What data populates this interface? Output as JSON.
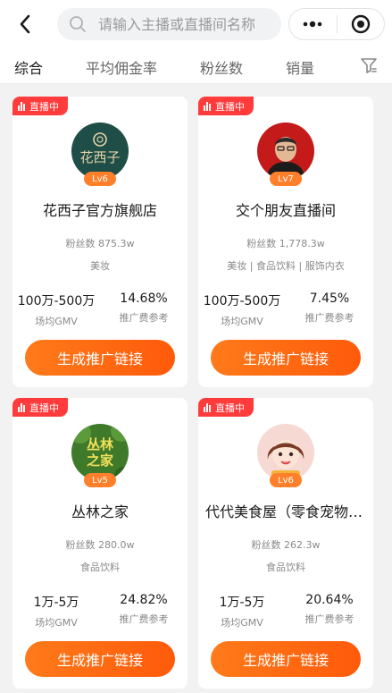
{
  "search": {
    "placeholder": "请输入主播或直播间名称"
  },
  "tabs": [
    {
      "label": "综合"
    },
    {
      "label": "平均佣金率"
    },
    {
      "label": "粉丝数"
    },
    {
      "label": "销量"
    }
  ],
  "cards": [
    {
      "live_label": "直播中",
      "level": "Lv6",
      "name": "花西子官方旗舰店",
      "fans": "粉丝数 875.3w",
      "categories": "美妆",
      "gmv": "100万-500万",
      "gmv_label": "场均GMV",
      "fee": "14.68%",
      "fee_label": "推广费参考",
      "cta": "生成推广链接",
      "avatar_text": "花西子"
    },
    {
      "live_label": "直播中",
      "level": "Lv7",
      "name": "交个朋友直播间",
      "fans": "粉丝数 1,778.3w",
      "categories": "美妆 | 食品饮料 | 服饰内衣",
      "gmv": "100万-500万",
      "gmv_label": "场均GMV",
      "fee": "7.45%",
      "fee_label": "推广费参考",
      "cta": "生成推广链接"
    },
    {
      "live_label": "直播中",
      "level": "Lv5",
      "name": "丛林之家",
      "fans": "粉丝数 280.0w",
      "categories": "食品饮料",
      "gmv": "1万-5万",
      "gmv_label": "场均GMV",
      "fee": "24.82%",
      "fee_label": "推广费参考",
      "cta": "生成推广链接",
      "avatar_text_1": "丛林",
      "avatar_text_2": "之家"
    },
    {
      "live_label": "直播中",
      "level": "Lv6",
      "name": "代代美食屋（零食宠物店）",
      "fans": "粉丝数 262.3w",
      "categories": "食品饮料",
      "gmv": "1万-5万",
      "gmv_label": "场均GMV",
      "fee": "20.64%",
      "fee_label": "推广费参考",
      "cta": "生成推广链接"
    }
  ],
  "icons": {
    "back": "chevron-left-icon",
    "search": "search-icon",
    "more": "more-dots-icon",
    "close": "target-close-icon",
    "filter": "filter-icon",
    "live": "live-bars-icon"
  },
  "colors": {
    "accent": "#ff6a14",
    "live_badge": "#ff3b3b",
    "level_badge": "#ff7f2a"
  }
}
